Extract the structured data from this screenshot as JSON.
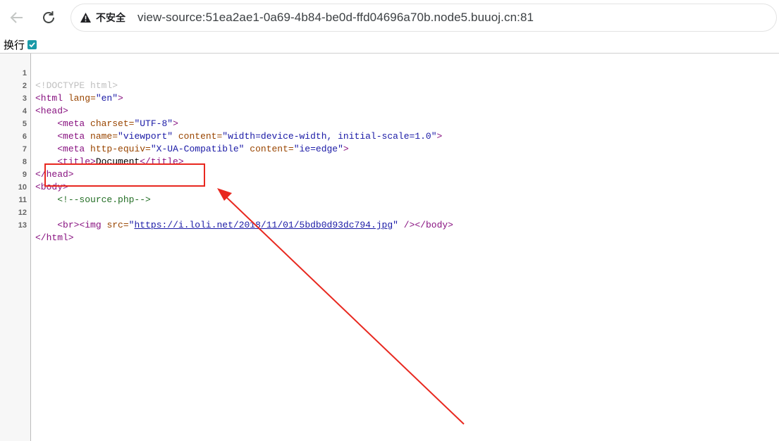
{
  "browser": {
    "security_label": "不安全",
    "url": "view-source:51ea2ae1-0a69-4b84-be0d-ffd04696a70b.node5.buuoj.cn:81",
    "icons": [
      "back-arrow-icon",
      "reload-icon",
      "warning-icon"
    ]
  },
  "wrap": {
    "label": "换行",
    "checked": true
  },
  "source": {
    "line_numbers": [
      "1",
      "2",
      "3",
      "4",
      "5",
      "6",
      "7",
      "8",
      "9",
      "10",
      "11",
      "12",
      "13"
    ],
    "l1": "<!DOCTYPE html>",
    "l2_open": "<html ",
    "l2_attr": "lang=",
    "l2_val": "\"en\"",
    "l2_close": ">",
    "l3": "<head>",
    "l4_open": "<meta ",
    "l4_attr": "charset=",
    "l4_val": "\"UTF-8\"",
    "l4_close": ">",
    "l5_open": "<meta ",
    "l5_attr1": "name=",
    "l5_val1": "\"viewport\"",
    "l5_attr2": " content=",
    "l5_val2": "\"width=device-width, initial-scale=1.0\"",
    "l5_close": ">",
    "l6_open": "<meta ",
    "l6_attr1": "http-equiv=",
    "l6_val1": "\"X-UA-Compatible\"",
    "l6_attr2": " content=",
    "l6_val2": "\"ie=edge\"",
    "l6_close": ">",
    "l7_open": "<title>",
    "l7_text": "Document",
    "l7_close": "</title>",
    "l8": "</head>",
    "l9": "<body>",
    "l10": "<!--source.php-->",
    "l12_br": "<br>",
    "l12_img": "<img ",
    "l12_attr": "src=",
    "l12_q1": "\"",
    "l12_link": "https://i.loli.net/2018/11/01/5bdb0d93dc794.jpg",
    "l12_q2": "\"",
    "l12_end": " />",
    "l12_body": "</body>",
    "l13": "</html>"
  },
  "annotation": {
    "color": "#e8281f"
  }
}
